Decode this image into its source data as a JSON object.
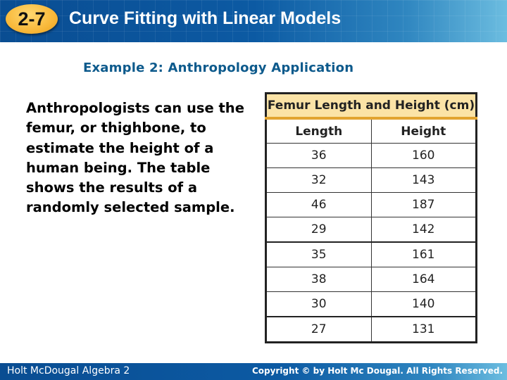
{
  "header": {
    "section_badge": "2-7",
    "title": "Curve Fitting with Linear Models"
  },
  "example_title": "Example 2: Anthropology Application",
  "body_text": "Anthropologists can use the femur, or thighbone, to estimate the height of a human being. The table shows the results of a randomly selected sample.",
  "table": {
    "caption": "Femur Length and Height (cm)",
    "columns": [
      "Length",
      "Height"
    ],
    "rows": [
      [
        "36",
        "160"
      ],
      [
        "32",
        "143"
      ],
      [
        "46",
        "187"
      ],
      [
        "29",
        "142"
      ],
      [
        "35",
        "161"
      ],
      [
        "38",
        "164"
      ],
      [
        "30",
        "140"
      ],
      [
        "27",
        "131"
      ]
    ]
  },
  "footer": {
    "left": "Holt McDougal Algebra 2",
    "right": "Copyright © by Holt Mc Dougal. All Rights Reserved."
  },
  "colors": {
    "header_blue": "#0c5aa3",
    "badge_orange": "#f8b83a",
    "example_title": "#0d5a8c",
    "table_caption_bg": "#fbe3a6",
    "table_caption_rule": "#e2a430"
  }
}
